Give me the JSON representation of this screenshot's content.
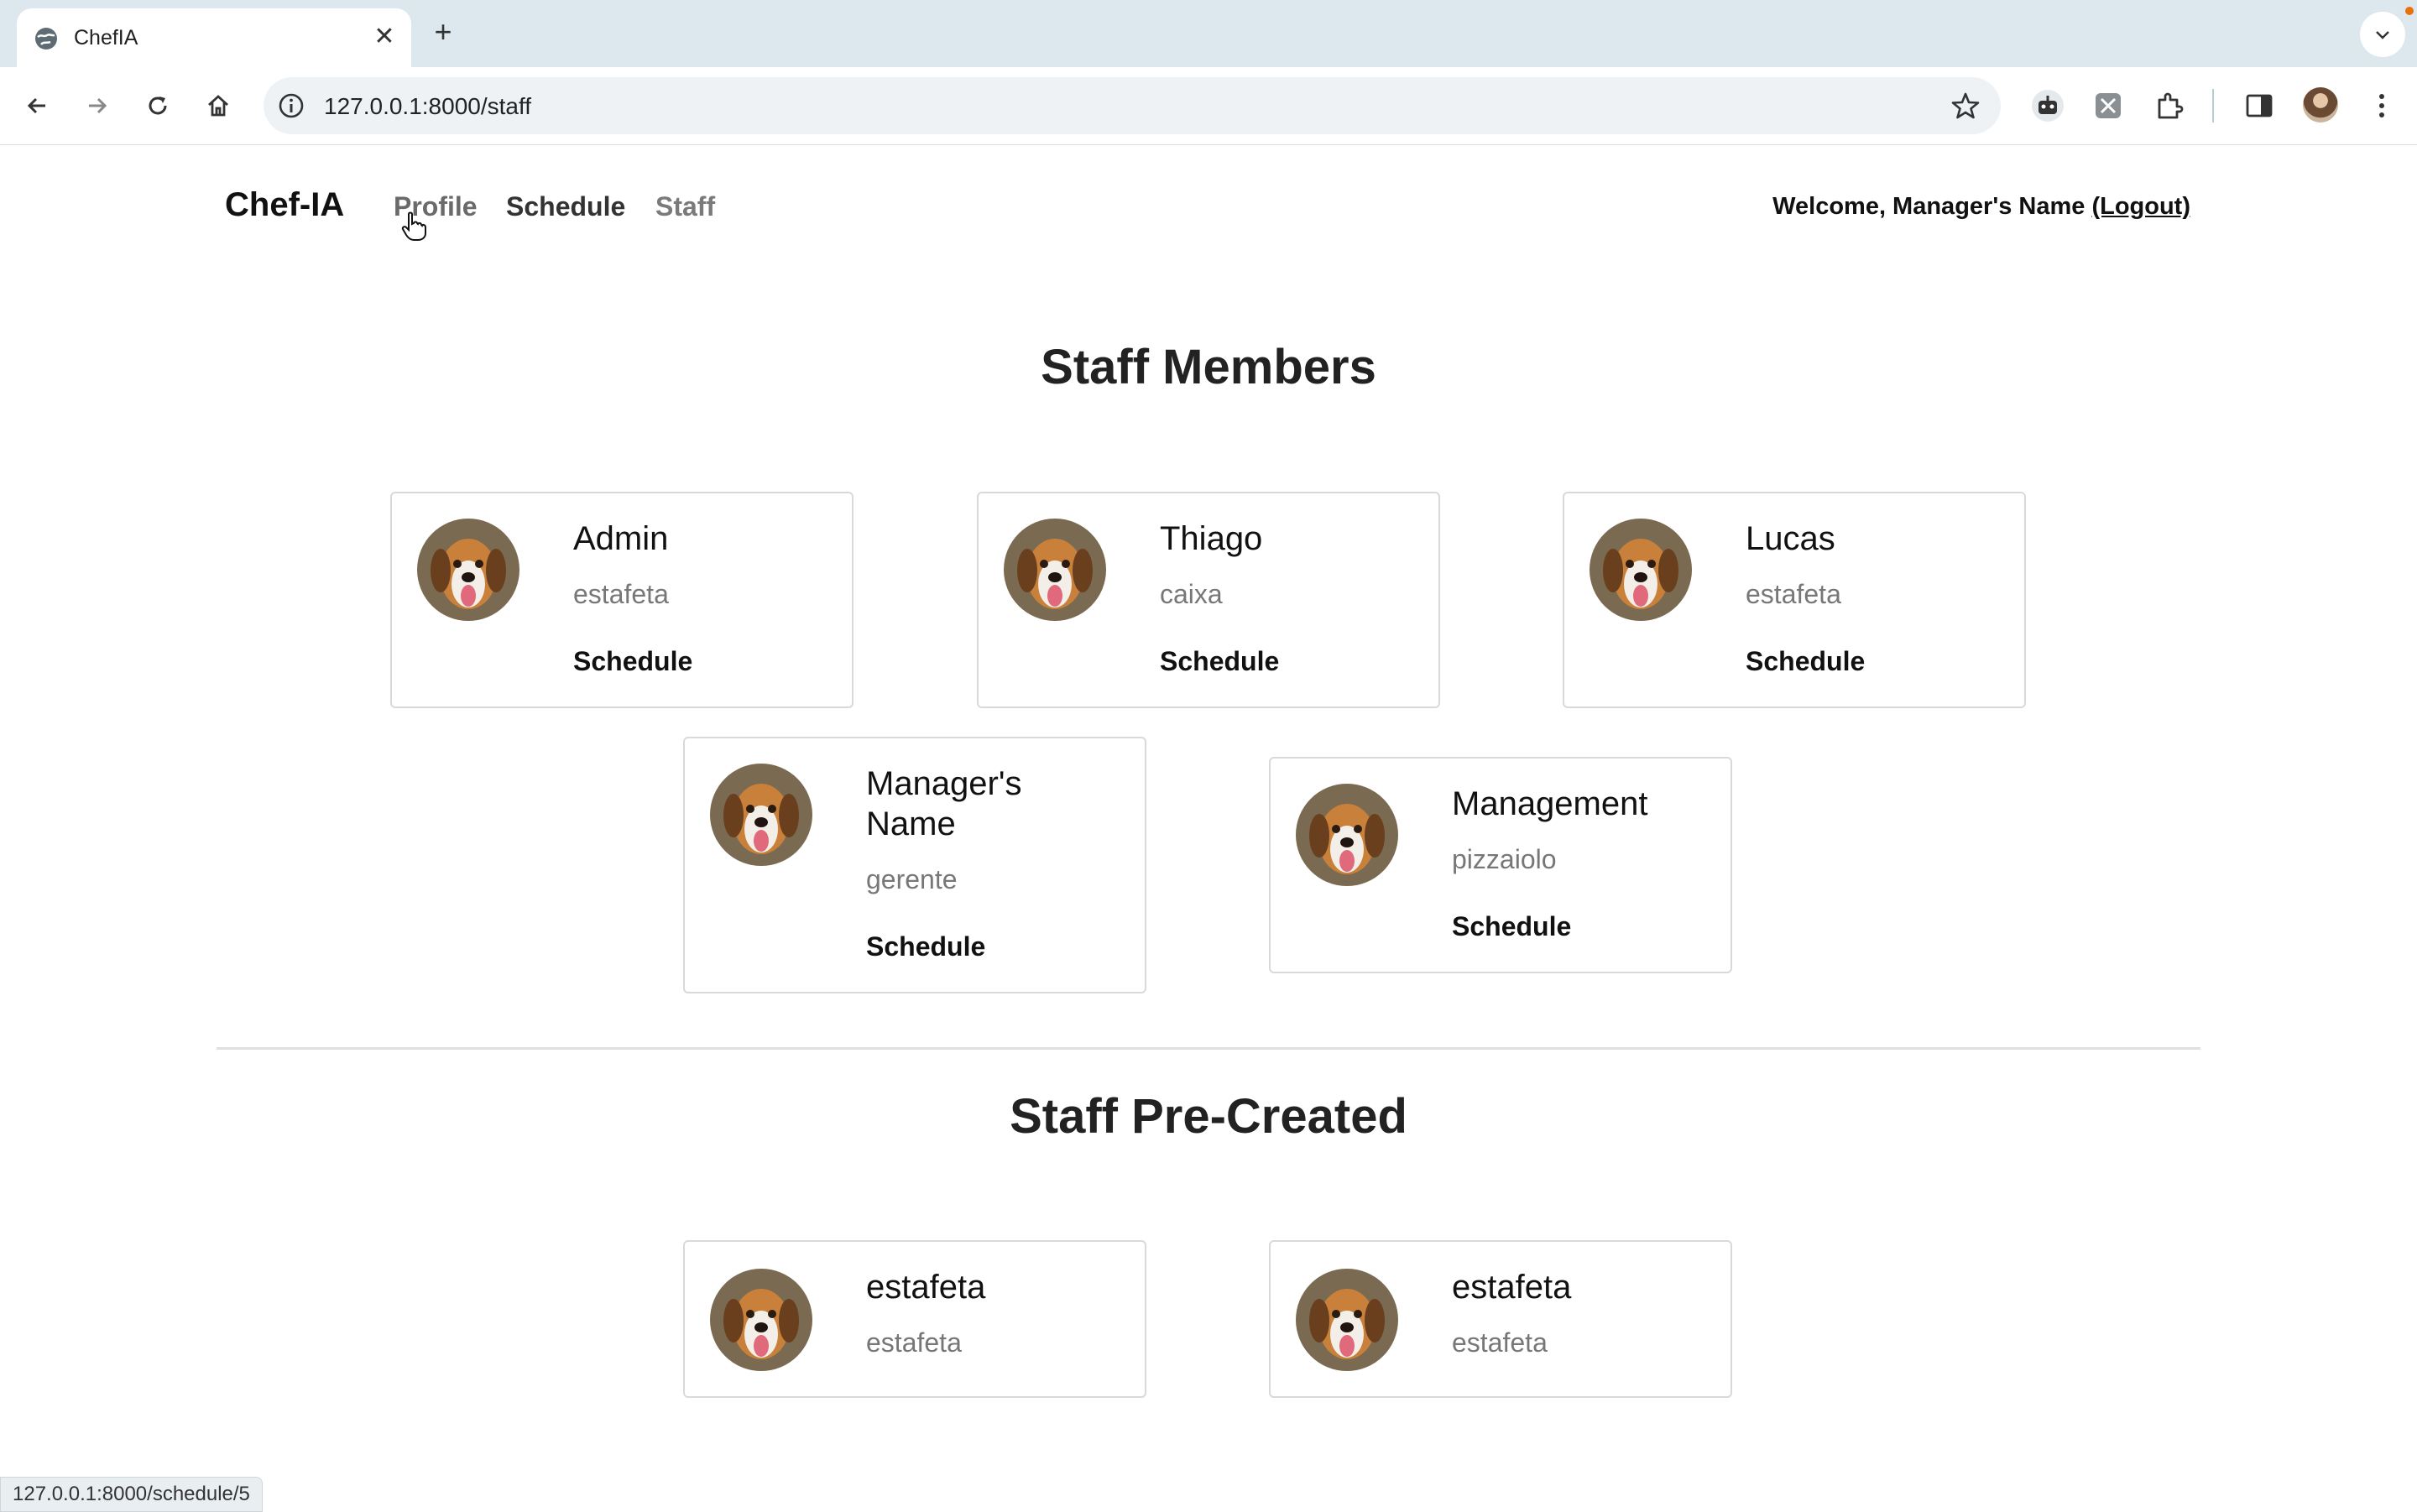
{
  "browser": {
    "tab_title": "ChefIA",
    "new_tab": "+",
    "close": "✕",
    "url": "127.0.0.1:8000/staff",
    "status_url": "127.0.0.1:8000/schedule/5"
  },
  "header": {
    "brand": "Chef-IA",
    "nav": [
      "Profile",
      "Schedule",
      "Staff"
    ],
    "welcome_prefix": "Welcome, Manager's Name ",
    "logout": "(Logout)"
  },
  "staff_members": {
    "title": "Staff Members",
    "items": [
      {
        "name": "Admin",
        "role": "estafeta",
        "link": "Schedule"
      },
      {
        "name": "Thiago",
        "role": "caixa",
        "link": "Schedule"
      },
      {
        "name": "Lucas",
        "role": "estafeta",
        "link": "Schedule"
      },
      {
        "name": "Manager's Name",
        "role": "gerente",
        "link": "Schedule"
      },
      {
        "name": "Management",
        "role": "pizzaiolo",
        "link": "Schedule"
      }
    ]
  },
  "staff_precreated": {
    "title": "Staff Pre-Created",
    "items": [
      {
        "name": "estafeta",
        "role": "estafeta"
      },
      {
        "name": "estafeta",
        "role": "estafeta"
      }
    ]
  },
  "colors": {
    "nav_profile": "#6a6a6a",
    "nav_schedule": "#333333",
    "nav_staff": "#7a7a7a"
  }
}
